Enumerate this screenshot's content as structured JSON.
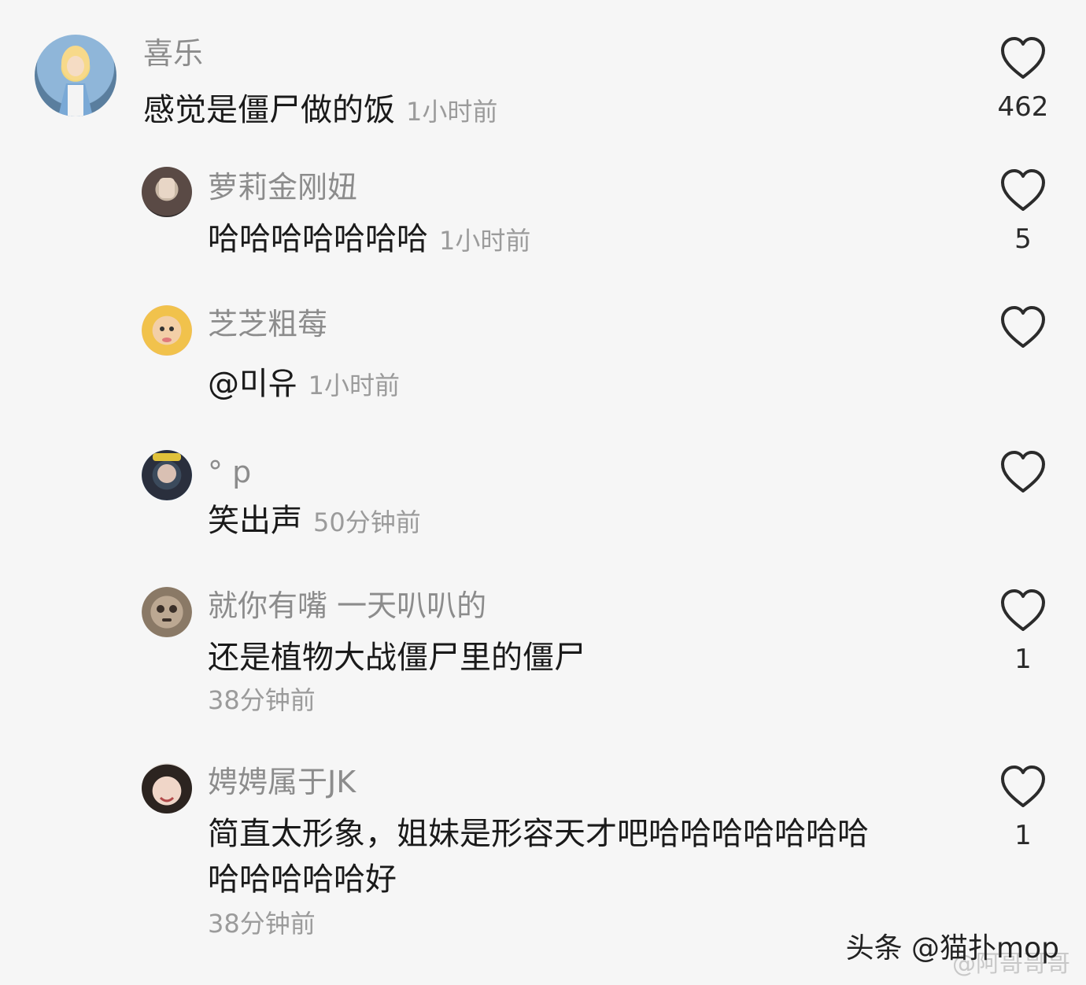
{
  "comments": [
    {
      "username": "喜乐",
      "text": "感觉是僵尸做的饭",
      "time": "1小时前",
      "likes": "462"
    },
    {
      "username": "萝莉金刚妞",
      "text": "哈哈哈哈哈哈哈",
      "time": "1小时前",
      "likes": "5"
    },
    {
      "username": "芝芝粗莓",
      "text": "@미유",
      "time": "1小时前",
      "likes": ""
    },
    {
      "username": "° p",
      "text": "笑出声",
      "time": "50分钟前",
      "likes": ""
    },
    {
      "username": "就你有嘴 一天叭叭的",
      "text": "还是植物大战僵尸里的僵尸",
      "time": "38分钟前",
      "likes": "1"
    },
    {
      "username": "娉娉属于JK",
      "text_line1": "简直太形象，姐妹是形容天才吧哈哈哈哈哈哈哈",
      "text_line2": "哈哈哈哈哈好",
      "time": "38分钟前",
      "likes": "1"
    }
  ],
  "watermark": "头条 @猫扑mop",
  "watermark_ghost": "@阿哥哥哥",
  "colors": {
    "background": "#f6f6f6",
    "username": "#8c8c8c",
    "time": "#9b9b9b",
    "text": "#1a1a1a"
  },
  "icons": {
    "like": "heart-outline-icon"
  }
}
